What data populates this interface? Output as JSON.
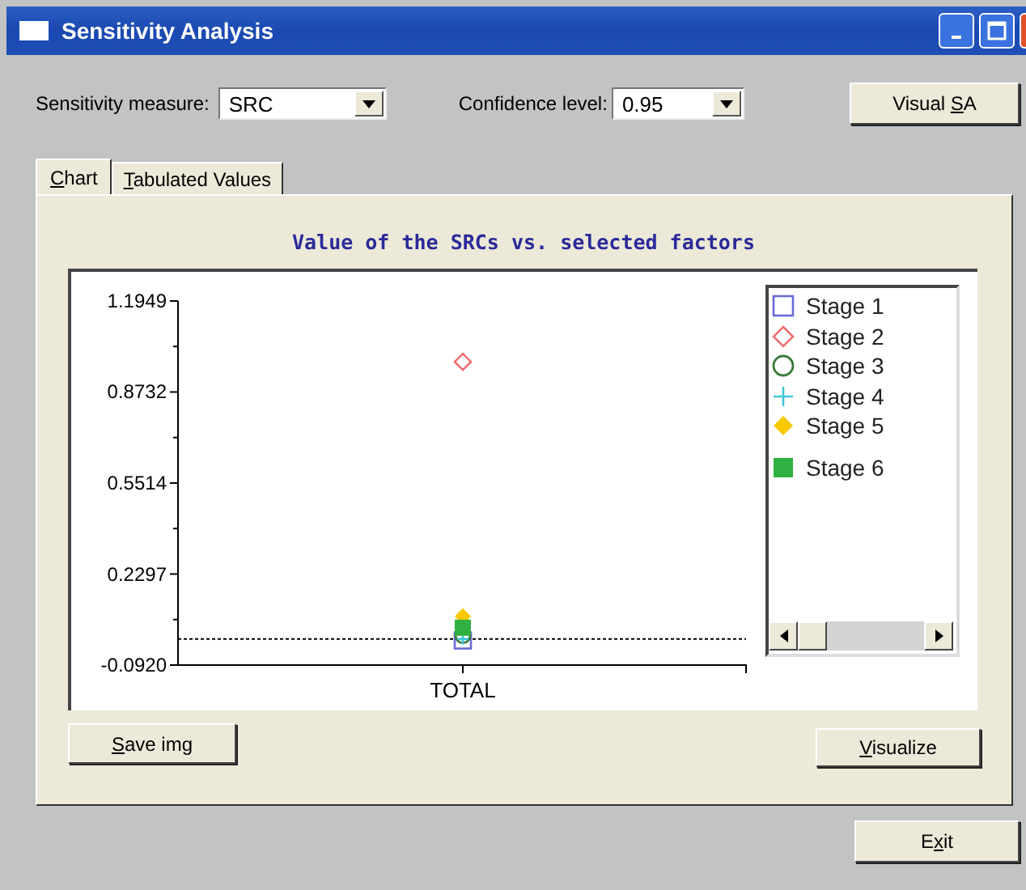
{
  "window": {
    "title": "Sensitivity Analysis"
  },
  "controls": {
    "measure_label": "Sensitivity measure:",
    "measure_value": "SRC",
    "confidence_label": "Confidence level:",
    "confidence_value": "0.95",
    "visual_button": {
      "label_before": "Visual ",
      "mnemonic": "S",
      "label_after": "A"
    }
  },
  "tabs": [
    {
      "mnemonic": "C",
      "label_after": "hart",
      "selected": true
    },
    {
      "mnemonic": "T",
      "label_after": "abulated Values",
      "selected": false
    }
  ],
  "chart": {
    "chart_data": {
      "type": "scatter",
      "title": "Value of the SRCs vs. selected factors",
      "legend": true,
      "categories": [
        "TOTAL"
      ],
      "yticks": [
        {
          "value": -0.092,
          "label": "-0.0920"
        },
        {
          "value": 0.2297,
          "label": "0.2297"
        },
        {
          "value": 0.5514,
          "label": "0.5514"
        },
        {
          "value": 0.8732,
          "label": "0.8732"
        },
        {
          "value": 1.1949,
          "label": "1.1949"
        }
      ],
      "ylim": [
        -0.092,
        1.1949
      ],
      "ref_lines": [
        {
          "axis": "y",
          "value": 0
        }
      ],
      "series": [
        {
          "name": "Stage 1",
          "color": "#6a6ad8",
          "marker": "square-open",
          "values": [
            -0.005
          ]
        },
        {
          "name": "Stage 2",
          "color": "#f07070",
          "marker": "diamond-open",
          "values": [
            0.98
          ]
        },
        {
          "name": "Stage 3",
          "color": "#3a7a3a",
          "marker": "circle-open",
          "values": [
            0.012
          ]
        },
        {
          "name": "Stage 4",
          "color": "#40c8d8",
          "marker": "plus",
          "values": [
            0.0
          ]
        },
        {
          "name": "Stage 5",
          "color": "#f8c800",
          "marker": "diamond-filled",
          "values": [
            0.08
          ]
        },
        {
          "name": "Stage 6",
          "color": "#30b040",
          "marker": "square-filled",
          "values": [
            0.04
          ]
        }
      ]
    }
  },
  "buttons": {
    "save": {
      "mnemonic": "S",
      "label_after": "ave img"
    },
    "visualize": {
      "mnemonic": "V",
      "label_after": "isualize"
    },
    "exit": {
      "label_before": "E",
      "mnemonic": "x",
      "label_after": "it"
    }
  }
}
